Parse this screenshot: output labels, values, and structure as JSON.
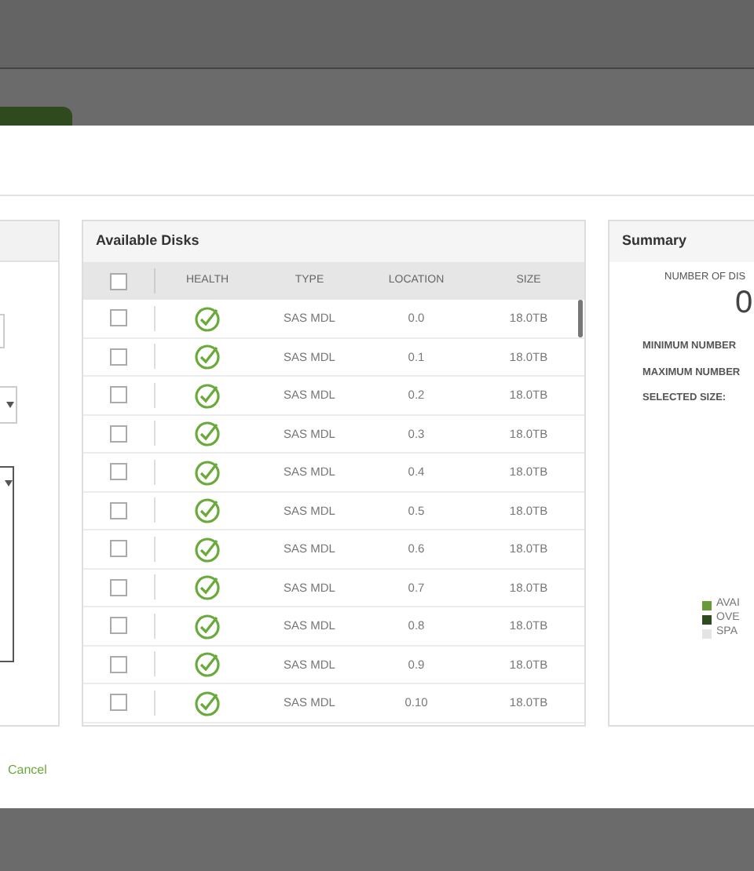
{
  "background_tab": {
    "selected": true
  },
  "disks_panel": {
    "title": "Available Disks",
    "columns": [
      {
        "label": "HEALTH"
      },
      {
        "label": "TYPE"
      },
      {
        "label": "LOCATION"
      },
      {
        "label": "SIZE"
      }
    ],
    "select_all": {
      "checked": false
    },
    "rows": [
      {
        "checked": false,
        "healthy": true,
        "type": "SAS MDL",
        "location": "0.0",
        "size": "18.0TB"
      },
      {
        "checked": false,
        "healthy": true,
        "type": "SAS MDL",
        "location": "0.1",
        "size": "18.0TB"
      },
      {
        "checked": false,
        "healthy": true,
        "type": "SAS MDL",
        "location": "0.2",
        "size": "18.0TB"
      },
      {
        "checked": false,
        "healthy": true,
        "type": "SAS MDL",
        "location": "0.3",
        "size": "18.0TB"
      },
      {
        "checked": false,
        "healthy": true,
        "type": "SAS MDL",
        "location": "0.4",
        "size": "18.0TB"
      },
      {
        "checked": false,
        "healthy": true,
        "type": "SAS MDL",
        "location": "0.5",
        "size": "18.0TB"
      },
      {
        "checked": false,
        "healthy": true,
        "type": "SAS MDL",
        "location": "0.6",
        "size": "18.0TB"
      },
      {
        "checked": false,
        "healthy": true,
        "type": "SAS MDL",
        "location": "0.7",
        "size": "18.0TB"
      },
      {
        "checked": false,
        "healthy": true,
        "type": "SAS MDL",
        "location": "0.8",
        "size": "18.0TB"
      },
      {
        "checked": false,
        "healthy": true,
        "type": "SAS MDL",
        "location": "0.9",
        "size": "18.0TB"
      },
      {
        "checked": false,
        "healthy": true,
        "type": "SAS MDL",
        "location": "0.10",
        "size": "18.0TB"
      }
    ]
  },
  "summary": {
    "title": "Summary",
    "count_label": "NUMBER OF DIS",
    "count": "0",
    "fields": [
      "MINIMUM NUMBER",
      "MAXIMUM NUMBER",
      "SELECTED SIZE:"
    ],
    "legend": [
      {
        "label": "AVAI",
        "color": "#6a9a3a"
      },
      {
        "label": "OVE",
        "color": "#2f4a1e"
      },
      {
        "label": "SPA",
        "color": "#e4e4e4"
      }
    ]
  },
  "cancel": "Cancel"
}
